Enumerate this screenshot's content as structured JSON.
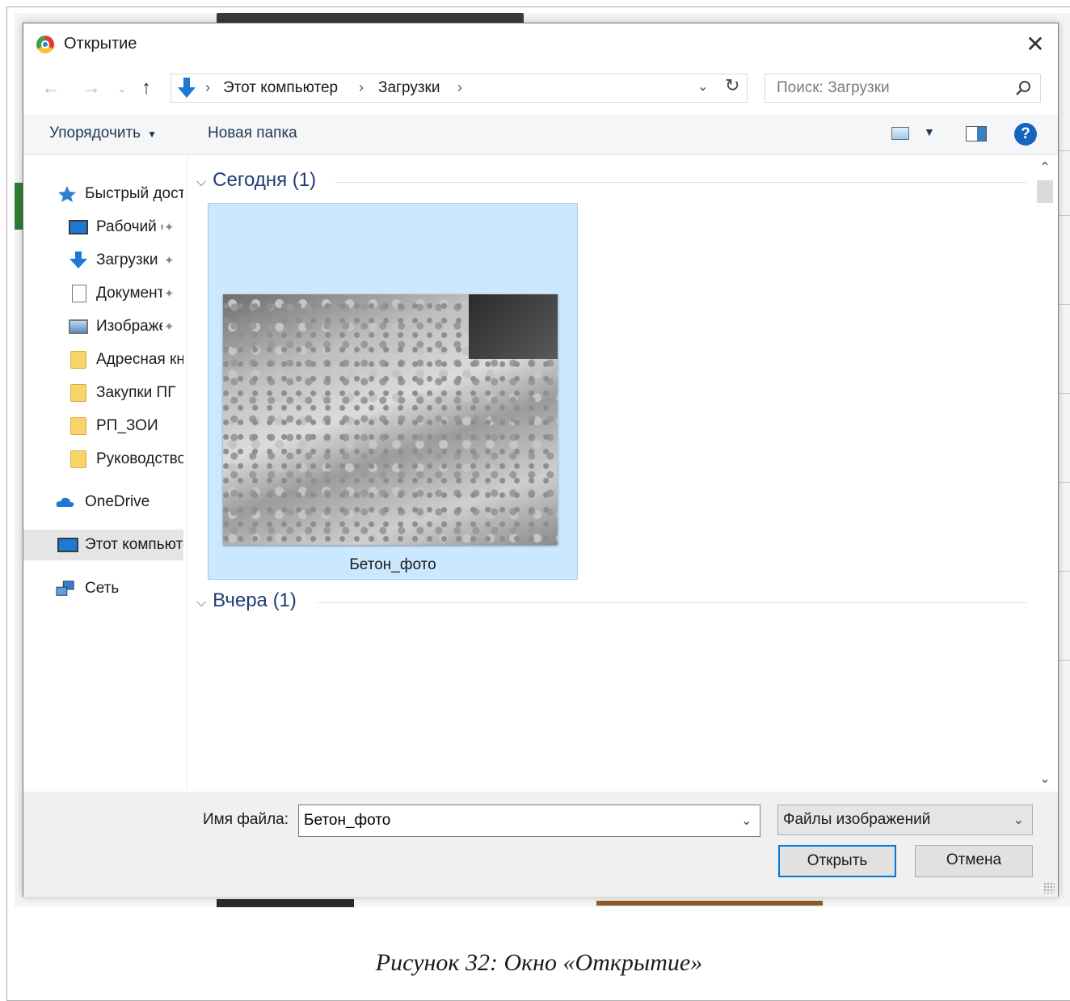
{
  "dialog": {
    "title": "Открытие",
    "address": {
      "crumbs": [
        "Этот компьютер",
        "Загрузки"
      ],
      "separator": "›"
    },
    "search": {
      "placeholder": "Поиск: Загрузки"
    },
    "toolbar": {
      "organize": "Упорядочить",
      "new_folder": "Новая папка",
      "help": "?"
    },
    "sidebar": {
      "items": [
        {
          "label": "Быстрый доступ",
          "icon": "star-icon"
        },
        {
          "label": "Рабочий стол",
          "icon": "desktop-icon",
          "pinned": true
        },
        {
          "label": "Загрузки",
          "icon": "download-icon",
          "pinned": true
        },
        {
          "label": "Документы",
          "icon": "documents-icon",
          "pinned": true
        },
        {
          "label": "Изображения",
          "icon": "pictures-icon",
          "pinned": true
        },
        {
          "label": "Адресная книга",
          "icon": "folder-icon"
        },
        {
          "label": "Закупки ПГ",
          "icon": "folder-icon"
        },
        {
          "label": "РП_ЗОИ",
          "icon": "folder-icon"
        },
        {
          "label": "Руководство",
          "icon": "folder-icon"
        },
        {
          "label": "OneDrive",
          "icon": "cloud-icon"
        },
        {
          "label": "Этот компьютер",
          "icon": "computer-icon",
          "selected": true
        },
        {
          "label": "Сеть",
          "icon": "network-icon"
        }
      ]
    },
    "groups": [
      {
        "header": "Сегодня (1)",
        "files": [
          {
            "name": "Бетон_фото",
            "selected": true
          }
        ]
      },
      {
        "header": "Вчера (1)",
        "files": []
      }
    ],
    "bottom": {
      "filename_label": "Имя файла:",
      "filename_value": "Бетон_фото",
      "filetype": "Файлы изображений",
      "open": "Открыть",
      "cancel": "Отмена"
    },
    "colors": {
      "accent": "#0078d7",
      "selection": "#cce8ff",
      "group_header": "#1f3d74"
    }
  },
  "caption": "Рисунок 32: Окно «Открытие»"
}
